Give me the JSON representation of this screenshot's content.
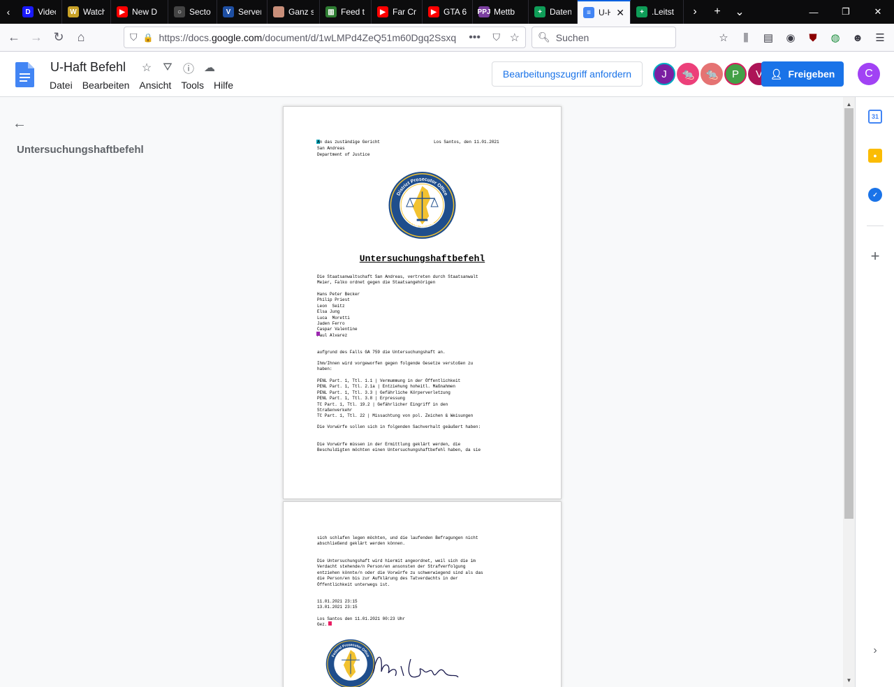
{
  "browser": {
    "tabs": [
      {
        "label": "Video",
        "favicon_color": "#1a1aff",
        "favicon_text": "D"
      },
      {
        "label": "Watch",
        "favicon_color": "#c9a227",
        "favicon_text": "W"
      },
      {
        "label": "New D",
        "favicon_color": "#ff0000",
        "favicon_text": "▶"
      },
      {
        "label": "Sector",
        "favicon_color": "#444444",
        "favicon_text": "○"
      },
      {
        "label": "Server",
        "favicon_color": "#1e4fa3",
        "favicon_text": "V"
      },
      {
        "label": "Ganz s",
        "favicon_color": "#c98f7a",
        "favicon_text": ""
      },
      {
        "label": "Feed t",
        "favicon_color": "#2e7d32",
        "favicon_text": "▥"
      },
      {
        "label": "Far Cry",
        "favicon_color": "#ff0000",
        "favicon_text": "▶"
      },
      {
        "label": "GTA 6",
        "favicon_color": "#ff0000",
        "favicon_text": "▶"
      },
      {
        "label": "Mettb",
        "favicon_color": "#7b3fa0",
        "favicon_text": "PPJ"
      },
      {
        "label": "Datenl",
        "favicon_color": "#0f9d58",
        "favicon_text": "+"
      },
      {
        "label": "U-H",
        "favicon_color": "#4285f4",
        "favicon_text": "≡",
        "active": true
      },
      {
        "label": ".Leitst",
        "favicon_color": "#0f9d58",
        "favicon_text": "+"
      }
    ],
    "url_prefix": "https://docs.",
    "url_host": "google.com",
    "url_path": "/document/d/1wLMPd4ZeQ51m60Dgq2Ssxq",
    "search_placeholder": "Suchen"
  },
  "docs": {
    "title": "U-Haft Befehl",
    "menu": [
      "Datei",
      "Bearbeiten",
      "Ansicht",
      "Tools",
      "Hilfe"
    ],
    "request_access": "Bearbeitungszugriff anfordern",
    "share": "Freigeben",
    "account_initial": "C",
    "collaborators": [
      {
        "initial": "J",
        "bg": "#7b1fa2",
        "border": "#00acc1"
      },
      {
        "initial": "🐀",
        "bg": "#ec407a",
        "border": "#ec407a"
      },
      {
        "initial": "🐀",
        "bg": "#e57373",
        "border": "#e57373"
      },
      {
        "initial": "P",
        "bg": "#43a047",
        "border": "#d81b60"
      },
      {
        "initial": "V",
        "bg": "#ad1457",
        "border": "#ad1457"
      }
    ]
  },
  "outline": {
    "heading": "Untersuchungshaftbefehl"
  },
  "document": {
    "address_line1": "An das zuständige Gericht",
    "date_line": "Los Santos, den 11.01.2021",
    "address_line2": "San Andreas",
    "address_line3": "Department of Justice",
    "seal_top_text": "District Prosecutor Office",
    "seal_bottom_text": "Los Santos",
    "heading": "Untersuchungshaftbefehl",
    "intro": "Die Staatsanwaltschaft San Andreas, vertreten durch Staatsanwalt\nMeier, Falko ordnet gegen die Staatsangehörigen",
    "persons": "Hans Peter Becker\nPhilip Priest\nLeon  Seitz\nElsa Jung\nLuca  Moretti\nJaden Ferro\nCaspar Valentine\nPaul Alvarez",
    "case_line": "aufgrund des Falls GA 759 die Untersuchungshaft an.",
    "accusation_intro": "Ihm/Ihnen wird vorgeworfen gegen folgende Gesetze verstoßen zu\nhaben:",
    "laws": "PENL Part. 1, Ttl. 1.1 | Vermummung in der Öffentlichkeit\nPENL Part. 1, Ttl. 2.1a | Entziehung hoheitl. Maßnahmen\nPENL Part. 1, Ttl. 3.3 | Gefährliche Körperverletzung\nPENL Part. 1, Ttl. 3.8 | Erpressung\nTC Part. 1, Ttl. 19.2 | Gefährlicher Eingriff in den\nStraßenverkehr\nTC Part. 1, Ttl. 22 | Missachtung von pol. Zeichen & Weisungen",
    "facts_intro": "Die Vorwürfe sollen sich in folgenden Sachverhalt geäußert haben:",
    "investigation": "Die Vorwürfe müssen in der Ermittlung geklärt werden, die\nBeschuldigten möchten einen Untersuchungshaftbefehl haben, da sie",
    "p2_continuation": "sich schlafen legen möchten, und die laufenden Befragungen nicht\nabschließend geklärt werden können.",
    "p2_order": "Die Untersuchungshaft wird hiermit angeordnet, weil sich die im\nVerdacht stehende/n Person/en ansonsten der Strafverfolgung\nentziehen könnte/n oder die Vorwürfe zu schwerwiegend sind als das\ndie Person/en bis zur Aufklärung des Tatverdachts in der\nÖffentlichkeit unterwegs ist.",
    "p2_dates": "11.01.2021 23:15\n13.01.2021 23:15",
    "p2_place_date": "Los Santos den 11.01.2021 00:23 Uhr",
    "p2_signed": "Gez.",
    "seal2_top_text": "Federal Prosecutor Office",
    "seal2_bottom_text": "United States of America"
  },
  "colors": {
    "accent_blue": "#1a73e8",
    "docs_blue": "#4285f4",
    "seal_navy": "#1f4e8c",
    "seal_gold": "#f2c230",
    "cursor_teal": "#00acc1",
    "cursor_purple": "#9c27b0",
    "cursor_pink": "#e91e63"
  }
}
